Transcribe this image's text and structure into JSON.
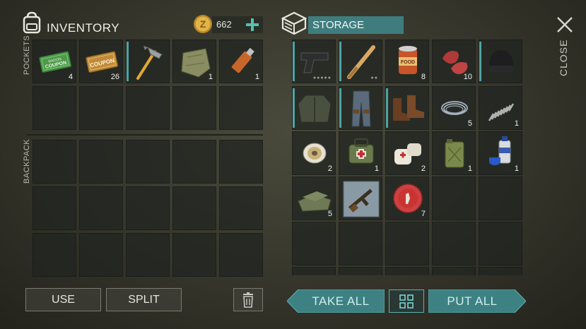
{
  "inventory": {
    "title": "INVENTORY",
    "currency_amount": "662",
    "pockets_label": "POCKETS",
    "backpack_label": "BACKPACK",
    "pockets": [
      {
        "icon": "ration-coupon-icon",
        "text": "RATION COUPON",
        "count": "4"
      },
      {
        "icon": "workbench-coupon-icon",
        "text": "COUPON",
        "count": "26"
      },
      {
        "icon": "hammer-icon",
        "count": "",
        "equipped": true
      },
      {
        "icon": "cloth-scrap-icon",
        "count": "1"
      },
      {
        "icon": "flash-drive-icon",
        "count": "1"
      }
    ]
  },
  "storage": {
    "title": "STORAGE",
    "items": [
      {
        "icon": "pistol-icon",
        "count": "",
        "equipped": true,
        "durability": "●●●●●"
      },
      {
        "icon": "baseball-bat-icon",
        "count": "",
        "equipped": true,
        "durability": "●●"
      },
      {
        "icon": "food-can-icon",
        "count": "8",
        "text": "FOOD"
      },
      {
        "icon": "raw-meat-icon",
        "count": "10"
      },
      {
        "icon": "beanie-hat-icon",
        "count": "",
        "equipped": true
      },
      {
        "icon": "leather-jacket-icon",
        "count": "",
        "equipped": true
      },
      {
        "icon": "jeans-icon",
        "count": "",
        "equipped": true
      },
      {
        "icon": "boots-icon",
        "count": "",
        "equipped": true
      },
      {
        "icon": "wire-coil-icon",
        "count": "5"
      },
      {
        "icon": "spring-icon",
        "count": "1"
      },
      {
        "icon": "tape-spool-icon",
        "count": "2"
      },
      {
        "icon": "medkit-bag-icon",
        "count": "1"
      },
      {
        "icon": "bandage-icon",
        "count": "2"
      },
      {
        "icon": "jerrycan-icon",
        "count": "1"
      },
      {
        "icon": "spray-can-icon",
        "count": "1"
      },
      {
        "icon": "cloth-pile-icon",
        "count": "5"
      },
      {
        "icon": "rifle-blueprint-icon",
        "count": ""
      },
      {
        "icon": "bottle-cap-icon",
        "count": "7"
      }
    ]
  },
  "buttons": {
    "use": "USE",
    "split": "SPLIT",
    "take_all": "TAKE ALL",
    "put_all": "PUT ALL",
    "close": "CLOSE"
  },
  "colors": {
    "accent": "#4fa3a4",
    "storage_bar": "#3f7c7e",
    "coin": "#d9a93a",
    "plus": "#56c0b0"
  }
}
